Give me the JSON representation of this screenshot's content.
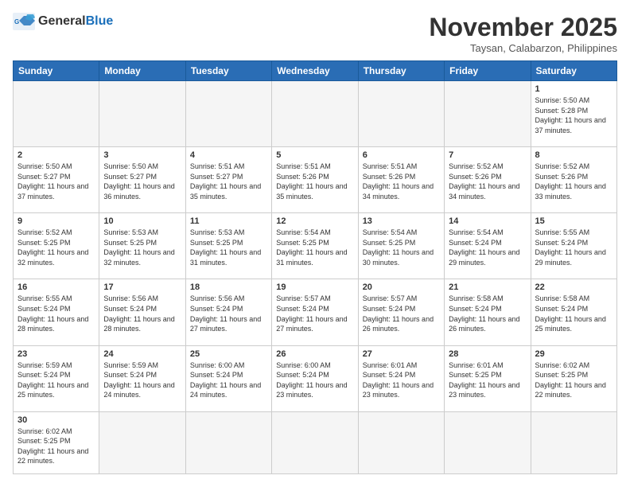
{
  "logo": {
    "text_general": "General",
    "text_blue": "Blue"
  },
  "header": {
    "month": "November 2025",
    "location": "Taysan, Calabarzon, Philippines"
  },
  "days_of_week": [
    "Sunday",
    "Monday",
    "Tuesday",
    "Wednesday",
    "Thursday",
    "Friday",
    "Saturday"
  ],
  "weeks": [
    [
      {
        "day": "",
        "empty": true
      },
      {
        "day": "",
        "empty": true
      },
      {
        "day": "",
        "empty": true
      },
      {
        "day": "",
        "empty": true
      },
      {
        "day": "",
        "empty": true
      },
      {
        "day": "",
        "empty": true
      },
      {
        "day": "1",
        "sunrise": "5:50 AM",
        "sunset": "5:28 PM",
        "daylight": "11 hours and 37 minutes."
      }
    ],
    [
      {
        "day": "2",
        "sunrise": "5:50 AM",
        "sunset": "5:27 PM",
        "daylight": "11 hours and 37 minutes."
      },
      {
        "day": "3",
        "sunrise": "5:50 AM",
        "sunset": "5:27 PM",
        "daylight": "11 hours and 36 minutes."
      },
      {
        "day": "4",
        "sunrise": "5:51 AM",
        "sunset": "5:27 PM",
        "daylight": "11 hours and 35 minutes."
      },
      {
        "day": "5",
        "sunrise": "5:51 AM",
        "sunset": "5:26 PM",
        "daylight": "11 hours and 35 minutes."
      },
      {
        "day": "6",
        "sunrise": "5:51 AM",
        "sunset": "5:26 PM",
        "daylight": "11 hours and 34 minutes."
      },
      {
        "day": "7",
        "sunrise": "5:52 AM",
        "sunset": "5:26 PM",
        "daylight": "11 hours and 34 minutes."
      },
      {
        "day": "8",
        "sunrise": "5:52 AM",
        "sunset": "5:26 PM",
        "daylight": "11 hours and 33 minutes."
      }
    ],
    [
      {
        "day": "9",
        "sunrise": "5:52 AM",
        "sunset": "5:25 PM",
        "daylight": "11 hours and 32 minutes."
      },
      {
        "day": "10",
        "sunrise": "5:53 AM",
        "sunset": "5:25 PM",
        "daylight": "11 hours and 32 minutes."
      },
      {
        "day": "11",
        "sunrise": "5:53 AM",
        "sunset": "5:25 PM",
        "daylight": "11 hours and 31 minutes."
      },
      {
        "day": "12",
        "sunrise": "5:54 AM",
        "sunset": "5:25 PM",
        "daylight": "11 hours and 31 minutes."
      },
      {
        "day": "13",
        "sunrise": "5:54 AM",
        "sunset": "5:25 PM",
        "daylight": "11 hours and 30 minutes."
      },
      {
        "day": "14",
        "sunrise": "5:54 AM",
        "sunset": "5:24 PM",
        "daylight": "11 hours and 29 minutes."
      },
      {
        "day": "15",
        "sunrise": "5:55 AM",
        "sunset": "5:24 PM",
        "daylight": "11 hours and 29 minutes."
      }
    ],
    [
      {
        "day": "16",
        "sunrise": "5:55 AM",
        "sunset": "5:24 PM",
        "daylight": "11 hours and 28 minutes."
      },
      {
        "day": "17",
        "sunrise": "5:56 AM",
        "sunset": "5:24 PM",
        "daylight": "11 hours and 28 minutes."
      },
      {
        "day": "18",
        "sunrise": "5:56 AM",
        "sunset": "5:24 PM",
        "daylight": "11 hours and 27 minutes."
      },
      {
        "day": "19",
        "sunrise": "5:57 AM",
        "sunset": "5:24 PM",
        "daylight": "11 hours and 27 minutes."
      },
      {
        "day": "20",
        "sunrise": "5:57 AM",
        "sunset": "5:24 PM",
        "daylight": "11 hours and 26 minutes."
      },
      {
        "day": "21",
        "sunrise": "5:58 AM",
        "sunset": "5:24 PM",
        "daylight": "11 hours and 26 minutes."
      },
      {
        "day": "22",
        "sunrise": "5:58 AM",
        "sunset": "5:24 PM",
        "daylight": "11 hours and 25 minutes."
      }
    ],
    [
      {
        "day": "23",
        "sunrise": "5:59 AM",
        "sunset": "5:24 PM",
        "daylight": "11 hours and 25 minutes."
      },
      {
        "day": "24",
        "sunrise": "5:59 AM",
        "sunset": "5:24 PM",
        "daylight": "11 hours and 24 minutes."
      },
      {
        "day": "25",
        "sunrise": "6:00 AM",
        "sunset": "5:24 PM",
        "daylight": "11 hours and 24 minutes."
      },
      {
        "day": "26",
        "sunrise": "6:00 AM",
        "sunset": "5:24 PM",
        "daylight": "11 hours and 23 minutes."
      },
      {
        "day": "27",
        "sunrise": "6:01 AM",
        "sunset": "5:24 PM",
        "daylight": "11 hours and 23 minutes."
      },
      {
        "day": "28",
        "sunrise": "6:01 AM",
        "sunset": "5:25 PM",
        "daylight": "11 hours and 23 minutes."
      },
      {
        "day": "29",
        "sunrise": "6:02 AM",
        "sunset": "5:25 PM",
        "daylight": "11 hours and 22 minutes."
      }
    ],
    [
      {
        "day": "30",
        "sunrise": "6:02 AM",
        "sunset": "5:25 PM",
        "daylight": "11 hours and 22 minutes."
      },
      {
        "day": "",
        "empty": true
      },
      {
        "day": "",
        "empty": true
      },
      {
        "day": "",
        "empty": true
      },
      {
        "day": "",
        "empty": true
      },
      {
        "day": "",
        "empty": true
      },
      {
        "day": "",
        "empty": true
      }
    ]
  ]
}
